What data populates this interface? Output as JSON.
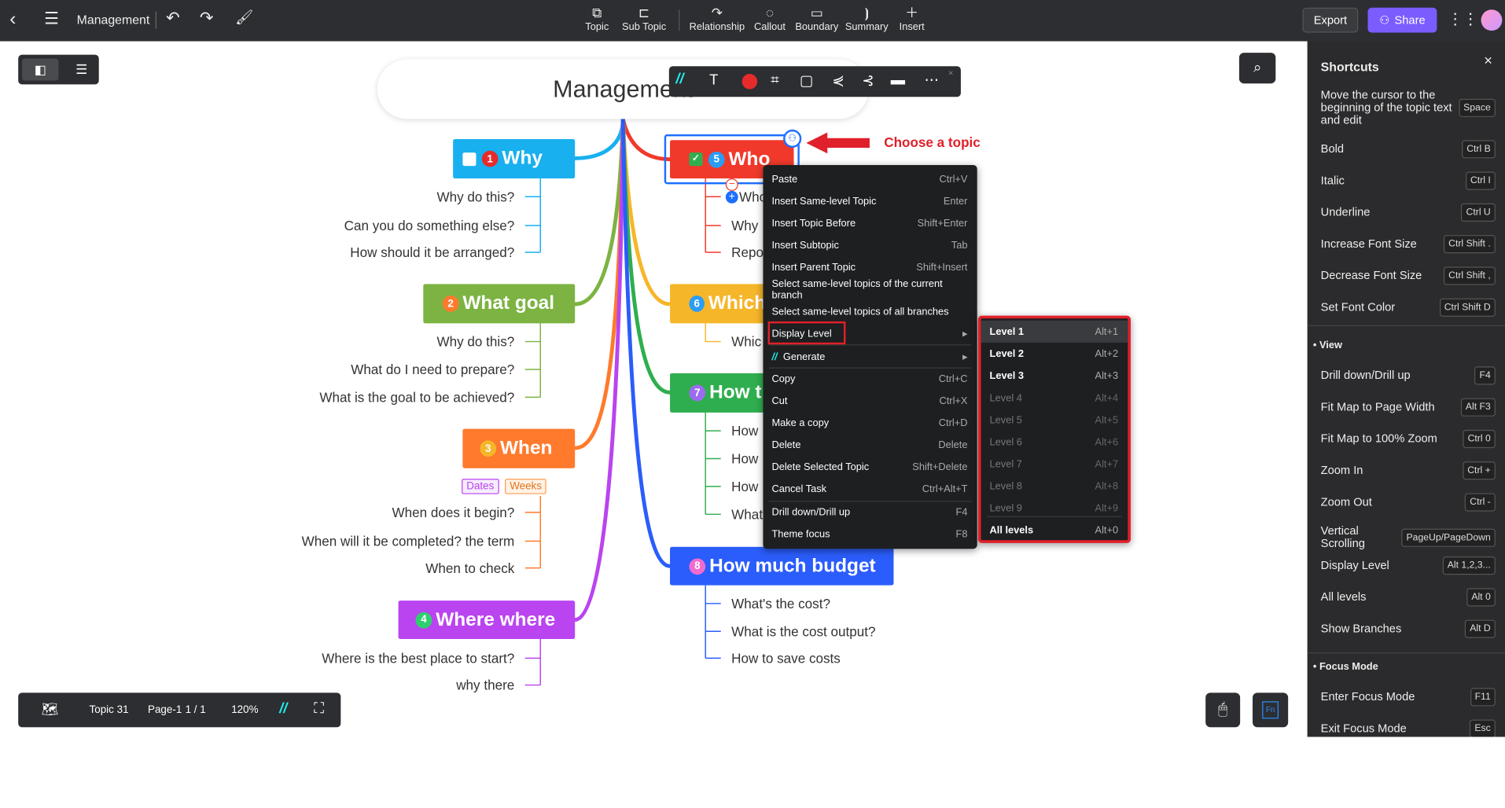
{
  "topbar": {
    "title": "Management",
    "tools": [
      "Topic",
      "Sub Topic",
      "Relationship",
      "Callout",
      "Boundary",
      "Summary",
      "Insert"
    ],
    "export": "Export",
    "share": "Share"
  },
  "colors": {
    "accent": "#7b5cff",
    "why": "#18b0ef",
    "goal": "#7cb342",
    "when": "#ff7a2c",
    "where": "#b944f0",
    "who": "#f0392b",
    "which": "#f6b62a",
    "how": "#2fae4f",
    "budget": "#2a5dfb",
    "highlight": "#e0202a"
  },
  "map": {
    "root": "Management",
    "left": [
      {
        "num": "1",
        "title": "Why",
        "subs": [
          "Why do this?",
          "Can you do something else?",
          "How should it be arranged?"
        ]
      },
      {
        "num": "2",
        "title": "What goal",
        "subs": [
          "Why do this?",
          "What do I need to prepare?",
          "What is the goal to be achieved?"
        ]
      },
      {
        "num": "3",
        "title": "When",
        "tags": [
          "Dates",
          "Weeks"
        ],
        "subs": [
          "When does it begin?",
          "When will it be completed? the term",
          "When to check"
        ]
      },
      {
        "num": "4",
        "title": "Where where",
        "subs": [
          "Where is the best place to start?",
          "why there"
        ]
      }
    ],
    "right": [
      {
        "num": "5",
        "title": "Who",
        "subs": [
          "Who",
          "Why",
          "Repo"
        ]
      },
      {
        "num": "6",
        "title": "Which",
        "subs": [
          "Whic"
        ]
      },
      {
        "num": "7",
        "title": "How t",
        "subs": [
          "How",
          "How",
          "How",
          "What"
        ]
      },
      {
        "num": "8",
        "title": "How much budget",
        "subs": [
          "What's the cost?",
          "What is the cost output?",
          "How to save costs"
        ]
      }
    ]
  },
  "annotation": "Choose a topic",
  "context_menu": [
    {
      "label": "Paste",
      "key": "Ctrl+V"
    },
    {
      "label": "Insert Same-level Topic",
      "key": "Enter"
    },
    {
      "label": "Insert Topic Before",
      "key": "Shift+Enter"
    },
    {
      "label": "Insert Subtopic",
      "key": "Tab"
    },
    {
      "label": "Insert Parent Topic",
      "key": "Shift+Insert"
    },
    {
      "label": "Select same-level topics of the current branch",
      "key": ""
    },
    {
      "label": "Select same-level topics of all branches",
      "key": ""
    },
    {
      "label": "Display Level",
      "key": "▸"
    },
    {
      "label": "Generate",
      "key": "▸"
    },
    {
      "label": "Copy",
      "key": "Ctrl+C"
    },
    {
      "label": "Cut",
      "key": "Ctrl+X"
    },
    {
      "label": "Make a copy",
      "key": "Ctrl+D"
    },
    {
      "label": "Delete",
      "key": "Delete"
    },
    {
      "label": "Delete Selected Topic",
      "key": "Shift+Delete"
    },
    {
      "label": "Cancel Task",
      "key": "Ctrl+Alt+T"
    },
    {
      "label": "Drill down/Drill up",
      "key": "F4"
    },
    {
      "label": "Theme focus",
      "key": "F8"
    }
  ],
  "submenu": [
    {
      "label": "Level 1",
      "key": "Alt+1"
    },
    {
      "label": "Level 2",
      "key": "Alt+2"
    },
    {
      "label": "Level 3",
      "key": "Alt+3"
    },
    {
      "label": "Level 4",
      "key": "Alt+4"
    },
    {
      "label": "Level 5",
      "key": "Alt+5"
    },
    {
      "label": "Level 6",
      "key": "Alt+6"
    },
    {
      "label": "Level 7",
      "key": "Alt+7"
    },
    {
      "label": "Level 8",
      "key": "Alt+8"
    },
    {
      "label": "Level 9",
      "key": "Alt+9"
    },
    {
      "label": "All levels",
      "key": "Alt+0"
    }
  ],
  "shortcuts": {
    "title": "Shortcuts",
    "items": [
      {
        "label": "Move the cursor to the beginning of the topic text and edit",
        "key": "Space"
      },
      {
        "label": "Bold",
        "key": "Ctrl B"
      },
      {
        "label": "Italic",
        "key": "Ctrl I"
      },
      {
        "label": "Underline",
        "key": "Ctrl U"
      },
      {
        "label": "Increase Font Size",
        "key": "Ctrl Shift ."
      },
      {
        "label": "Decrease Font Size",
        "key": "Ctrl Shift ,"
      },
      {
        "label": "Set Font Color",
        "key": "Ctrl Shift D"
      }
    ],
    "view_title": "View",
    "view": [
      {
        "label": "Drill down/Drill up",
        "key": "F4"
      },
      {
        "label": "Fit Map to Page Width",
        "key": "Alt F3"
      },
      {
        "label": "Fit Map to 100% Zoom",
        "key": "Ctrl 0"
      },
      {
        "label": "Zoom In",
        "key": "Ctrl +"
      },
      {
        "label": "Zoom Out",
        "key": "Ctrl -"
      },
      {
        "label": "Vertical Scrolling",
        "key": "PageUp/PageDown"
      },
      {
        "label": "Display Level",
        "key": "Alt 1,2,3..."
      },
      {
        "label": "All levels",
        "key": "Alt 0"
      },
      {
        "label": "Show Branches",
        "key": "Alt D"
      }
    ],
    "focus_title": "Focus Mode",
    "focus": [
      {
        "label": "Enter Focus Mode",
        "key": "F11"
      },
      {
        "label": "Exit Focus Mode",
        "key": "Esc"
      }
    ]
  },
  "bottombar": {
    "topic_count": "Topic 31",
    "page": "Page-1",
    "page_num": "1 / 1",
    "zoom": "120%"
  },
  "fn_label": "Fn"
}
